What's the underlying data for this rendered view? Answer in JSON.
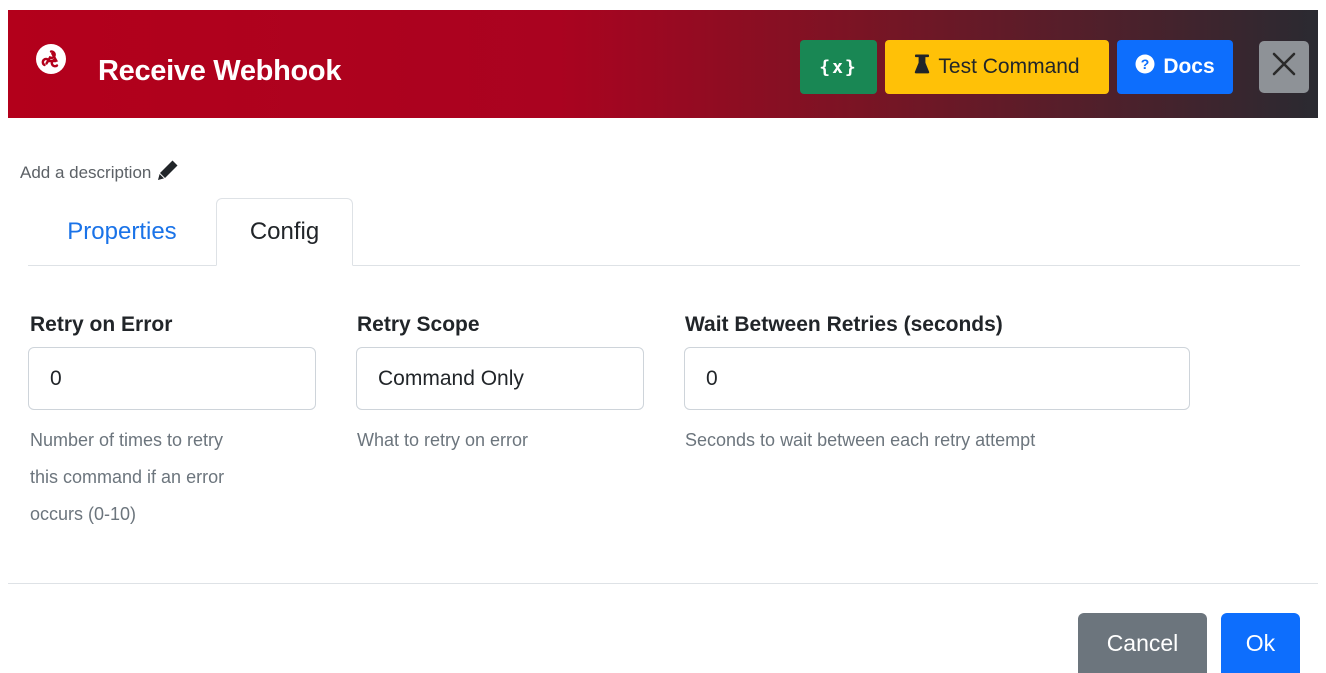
{
  "header": {
    "app_icon": "webhook-icon",
    "title": "Receive Webhook",
    "variables_button": "{x}",
    "test_button": "Test Command",
    "test_icon": "flask-icon",
    "docs_button": "Docs",
    "docs_icon": "question-circle-icon",
    "close_icon": "close-icon"
  },
  "description": {
    "text": "Add a description",
    "icon": "pencil-icon"
  },
  "tabs": [
    {
      "label": "Properties",
      "active": false
    },
    {
      "label": "Config",
      "active": true
    }
  ],
  "fields": {
    "retry_on_error": {
      "label": "Retry on Error",
      "value": "0",
      "help_lines": [
        "Number of times to retry",
        "this command if an error",
        "occurs (0-10)"
      ]
    },
    "retry_scope": {
      "label": "Retry Scope",
      "value": "Command Only",
      "help": "What to retry on error"
    },
    "wait_between_retries": {
      "label": "Wait Between Retries (seconds)",
      "value": "0",
      "help": "Seconds to wait between each retry attempt"
    }
  },
  "footer": {
    "cancel": "Cancel",
    "ok": "Ok"
  },
  "colors": {
    "header_start": "#b3001b",
    "header_end": "#2a2a31",
    "variables_button": "#198754",
    "test_button": "#ffc107",
    "docs_button": "#0d6efd",
    "close_button": "#8e9297",
    "cancel_button": "#6c757d",
    "ok_button": "#0d6efd",
    "active_tab_link": "#1a73e8"
  }
}
